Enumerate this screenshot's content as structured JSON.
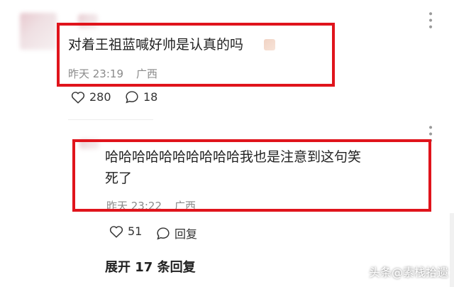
{
  "comment1": {
    "text": "对着王祖蓝喊好帅是认真的吗",
    "time": "昨天 23:19",
    "location": "广西",
    "likes": "280",
    "replies": "18"
  },
  "comment2": {
    "text_line1": "哈哈哈哈哈哈哈哈哈哈我也是注意到这句笑",
    "text_line2": "死了",
    "time": "昨天 23:22",
    "location": "广西",
    "likes": "51",
    "reply_label": "回复"
  },
  "expand_replies": "展开 17 条回复",
  "watermark": "头条@素栈拾遗",
  "colors": {
    "highlight_box": "#e0141c",
    "meta_gray": "#8a8a8a"
  },
  "icons": [
    "heart-icon",
    "comment-bubble-icon",
    "more-icon"
  ]
}
